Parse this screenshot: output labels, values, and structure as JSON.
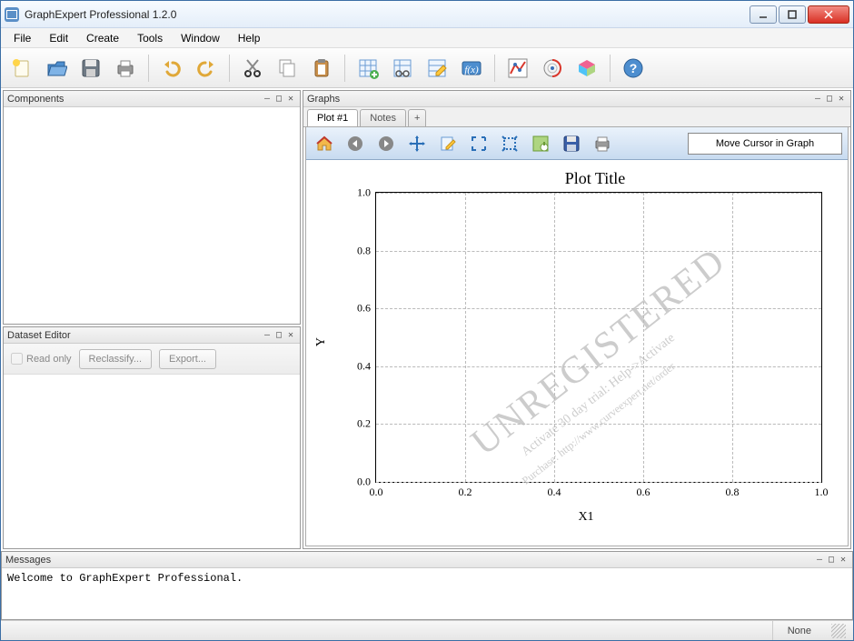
{
  "app": {
    "title": "GraphExpert Professional 1.2.0"
  },
  "menu": {
    "file": "File",
    "edit": "Edit",
    "create": "Create",
    "tools": "Tools",
    "window": "Window",
    "help": "Help"
  },
  "panels": {
    "components": "Components",
    "dataset_editor": "Dataset Editor",
    "graphs": "Graphs",
    "messages": "Messages"
  },
  "dataset_editor": {
    "read_only": "Read only",
    "reclassify": "Reclassify...",
    "export": "Export..."
  },
  "tabs": {
    "plot1": "Plot #1",
    "notes": "Notes",
    "add": "+"
  },
  "plot_toolbar": {
    "cursor_readout": "Move Cursor in Graph"
  },
  "messages": {
    "welcome": "Welcome to GraphExpert Professional."
  },
  "status": {
    "right": "None"
  },
  "watermark": {
    "main": "UNREGISTERED",
    "l2": "Activate 30 day trial: Help->Activate",
    "l3": "Purchase: http://www.curveexpert.net/order"
  },
  "chart_data": {
    "type": "line",
    "title": "Plot Title",
    "xlabel": "X1",
    "ylabel": "Y",
    "xlim": [
      0.0,
      1.0
    ],
    "ylim": [
      0.0,
      1.0
    ],
    "xticks": [
      0.0,
      0.2,
      0.4,
      0.6,
      0.8,
      1.0
    ],
    "yticks": [
      0.0,
      0.2,
      0.4,
      0.6,
      0.8,
      1.0
    ],
    "series": []
  }
}
